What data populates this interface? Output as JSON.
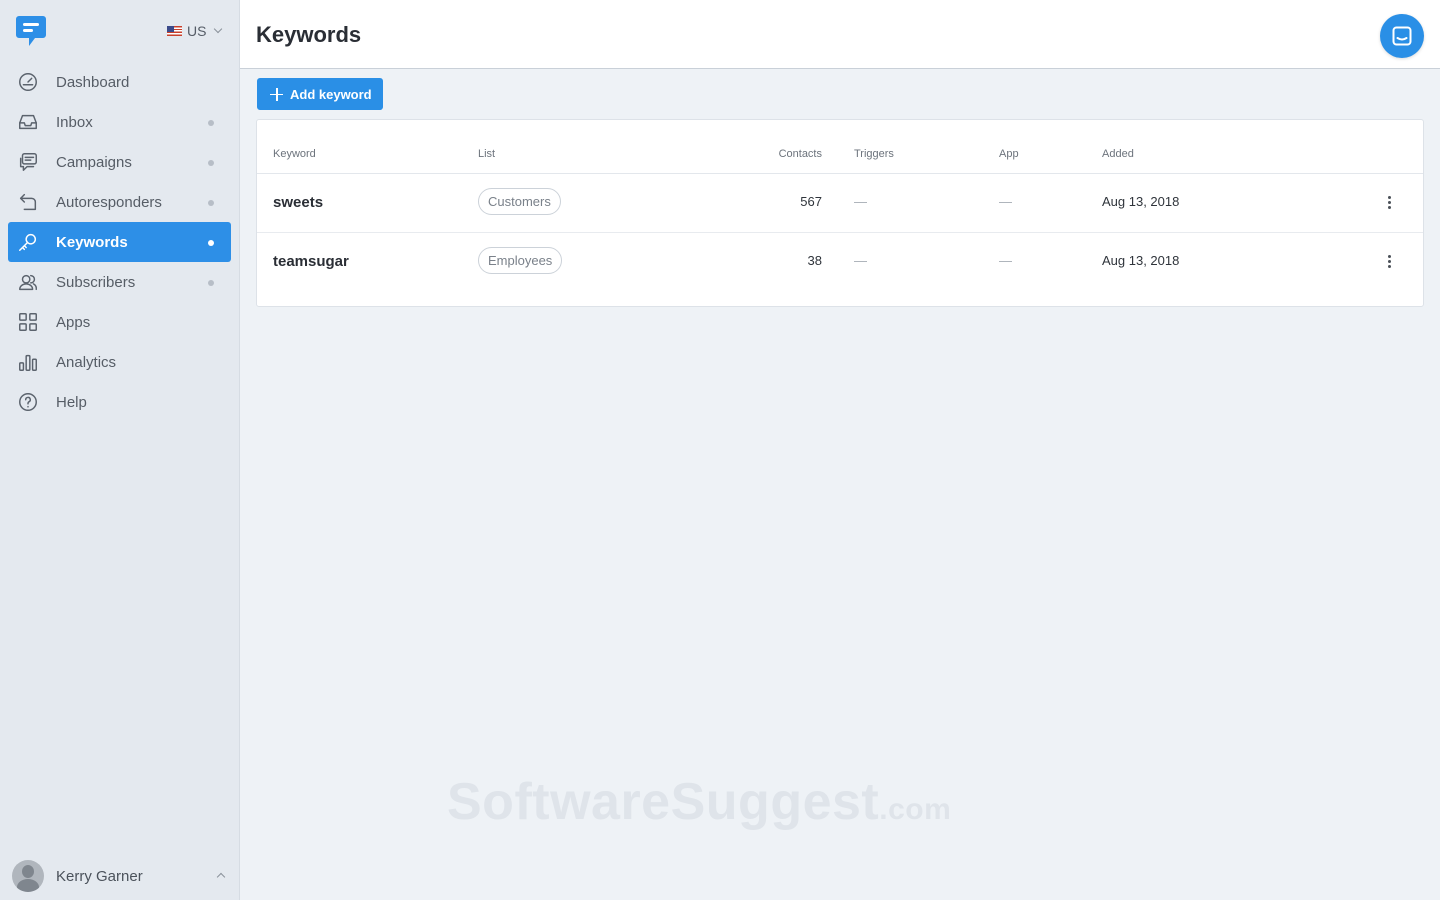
{
  "app": {
    "region": "US"
  },
  "sidebar": {
    "items": [
      {
        "label": "Dashboard",
        "icon": "dashboard-icon",
        "dot": false,
        "active": false
      },
      {
        "label": "Inbox",
        "icon": "inbox-icon",
        "dot": true,
        "active": false
      },
      {
        "label": "Campaigns",
        "icon": "campaigns-icon",
        "dot": true,
        "active": false
      },
      {
        "label": "Autoresponders",
        "icon": "autoresponders-icon",
        "dot": true,
        "active": false
      },
      {
        "label": "Keywords",
        "icon": "key-icon",
        "dot": true,
        "active": true
      },
      {
        "label": "Subscribers",
        "icon": "subscribers-icon",
        "dot": true,
        "active": false
      },
      {
        "label": "Apps",
        "icon": "apps-grid-icon",
        "dot": false,
        "active": false
      },
      {
        "label": "Analytics",
        "icon": "analytics-icon",
        "dot": false,
        "active": false
      },
      {
        "label": "Help",
        "icon": "help-icon",
        "dot": false,
        "active": false
      }
    ],
    "user": {
      "name": "Kerry Garner"
    }
  },
  "header": {
    "title": "Keywords"
  },
  "toolbar": {
    "add_label": "Add keyword"
  },
  "table": {
    "columns": [
      "Keyword",
      "List",
      "Contacts",
      "Triggers",
      "App",
      "Added"
    ],
    "rows": [
      {
        "keyword": "sweets",
        "list": "Customers",
        "contacts": "567",
        "triggers": "—",
        "app": "—",
        "added": "Aug 13, 2018"
      },
      {
        "keyword": "teamsugar",
        "list": "Employees",
        "contacts": "38",
        "triggers": "—",
        "app": "—",
        "added": "Aug 13, 2018"
      }
    ]
  },
  "watermark": {
    "main": "SoftwareSuggest",
    "suffix": ".com"
  },
  "colors": {
    "accent": "#2d8fe7",
    "sidebar_bg": "#e4e9ef",
    "content_bg": "#eef2f6"
  }
}
